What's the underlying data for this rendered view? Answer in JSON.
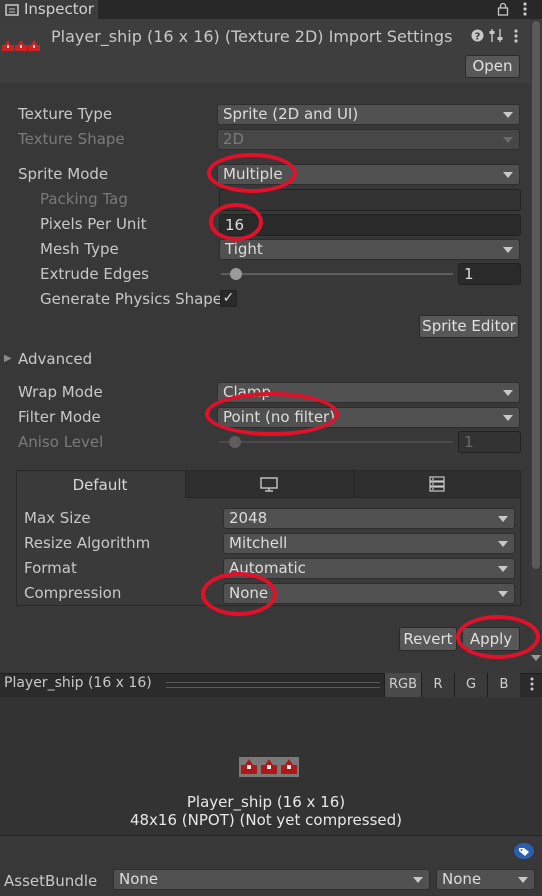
{
  "tab": {
    "label": "Inspector",
    "lock_icon": "lock-icon",
    "menu_icon": "kebab-icon"
  },
  "header": {
    "title": "Player_ship (16 x 16) (Texture 2D) Import Settings",
    "open_button": "Open",
    "help_icon": "help-icon",
    "presets_icon": "sliders-icon",
    "menu_icon": "kebab-icon"
  },
  "settings": {
    "texture_type": {
      "label": "Texture Type",
      "value": "Sprite (2D and UI)"
    },
    "texture_shape": {
      "label": "Texture Shape",
      "value": "2D"
    },
    "sprite_mode": {
      "label": "Sprite Mode",
      "value": "Multiple"
    },
    "packing_tag": {
      "label": "Packing Tag",
      "value": ""
    },
    "pixels_per_unit": {
      "label": "Pixels Per Unit",
      "value": "16"
    },
    "mesh_type": {
      "label": "Mesh Type",
      "value": "Tight"
    },
    "extrude_edges": {
      "label": "Extrude Edges",
      "value": "1",
      "slider_fraction": 0.04
    },
    "generate_physics_shape": {
      "label": "Generate Physics Shape",
      "checked": true,
      "check_glyph": "✓"
    },
    "sprite_editor_button": "Sprite Editor",
    "advanced": {
      "label": "Advanced",
      "arrow": "▶"
    },
    "wrap_mode": {
      "label": "Wrap Mode",
      "value": "Clamp"
    },
    "filter_mode": {
      "label": "Filter Mode",
      "value": "Point (no filter)"
    },
    "aniso_level": {
      "label": "Aniso Level",
      "value": "1",
      "slider_fraction": 0.06
    }
  },
  "platform": {
    "tabs": [
      {
        "label": "Default",
        "icon": ""
      },
      {
        "label": "",
        "icon": "monitor-icon"
      },
      {
        "label": "",
        "icon": "server-icon"
      }
    ],
    "max_size": {
      "label": "Max Size",
      "value": "2048"
    },
    "resize_algorithm": {
      "label": "Resize Algorithm",
      "value": "Mitchell"
    },
    "format": {
      "label": "Format",
      "value": "Automatic"
    },
    "compression": {
      "label": "Compression",
      "value": "None"
    }
  },
  "actions": {
    "revert": "Revert",
    "apply": "Apply"
  },
  "preview": {
    "title": "Player_ship (16 x 16)",
    "channels": [
      "RGB",
      "R",
      "G",
      "B"
    ],
    "name": "Player_ship (16 x 16)",
    "info": "48x16 (NPOT) (Not yet compressed)"
  },
  "asset_bundle": {
    "label": "AssetBundle",
    "name_value": "None",
    "variant_value": "None",
    "tag_icon": "tag-icon"
  },
  "colors": {
    "annotation": "#e3102a",
    "background": "#383838"
  }
}
